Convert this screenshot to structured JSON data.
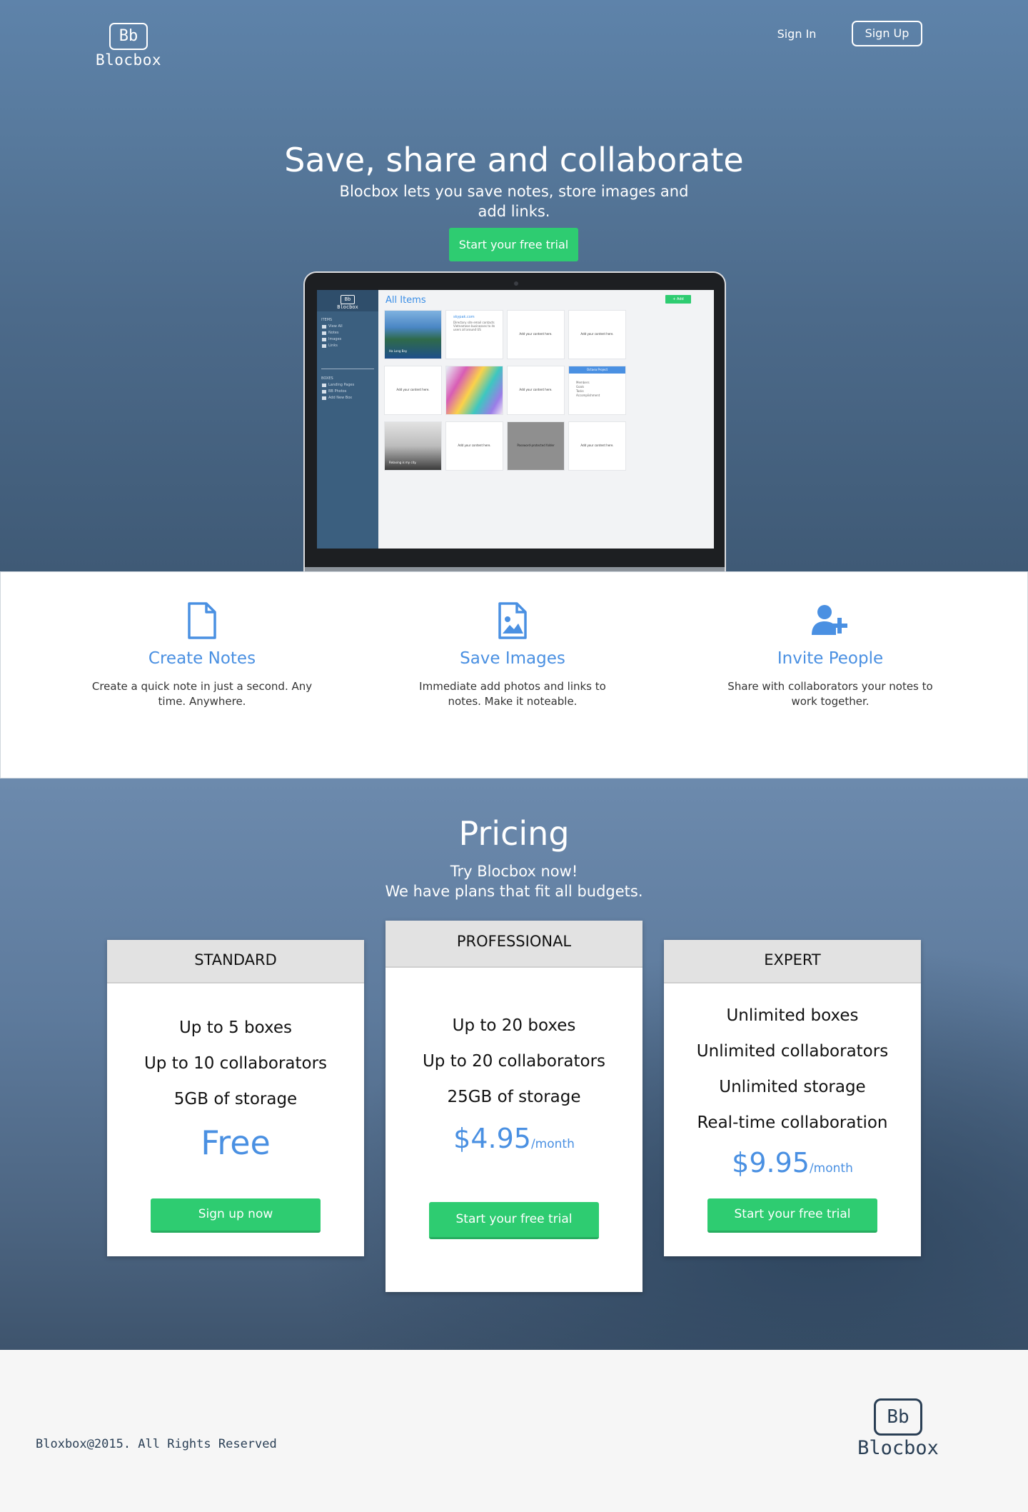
{
  "brand": {
    "logo_mark": "Bb",
    "name": "Blocbox"
  },
  "nav": {
    "sign_in": "Sign In",
    "sign_up": "Sign Up"
  },
  "hero": {
    "title": "Save, share and collaborate",
    "subtitle": "Blocbox lets you save notes, store images and add links.",
    "cta": "Start your free trial"
  },
  "app_preview": {
    "logo_mark": "Bb",
    "logo_name": "Blocbox",
    "title": "All Items",
    "add_label": "+ Add",
    "sidebar_items": [
      "ITEMS",
      "View All",
      "Notes",
      "Images",
      "Links"
    ],
    "sidebar_boxes": [
      "BOXES",
      "Landing Pages",
      "BB Photos",
      "Add New Box"
    ],
    "placeholder": "Add your content here.",
    "link_card_title": "skypak.com",
    "link_card_text": "Directory site email contacts Vietnamese businesses to its users all around US",
    "image_caption_1": "Ha Long Bay",
    "image_caption_2": "Relaxing is my city.",
    "folder_label": "Password-protected folder",
    "project_title": "Octaea Project",
    "project_items": [
      "Members",
      "Goals",
      "Tasks",
      "Accomplishment"
    ]
  },
  "features": [
    {
      "title": "Create Notes",
      "text": "Create a quick note in just a second. Any time. Anywhere.",
      "icon": "document-icon"
    },
    {
      "title": "Save Images",
      "text": "Immediate add photos and links to notes. Make it noteable.",
      "icon": "image-icon"
    },
    {
      "title": "Invite People",
      "text": "Share with collaborators your notes to work together.",
      "icon": "add-user-icon"
    }
  ],
  "pricing": {
    "title": "Pricing",
    "subtitle_1": "Try Blocbox now!",
    "subtitle_2": "We have plans that fit all budgets.",
    "plans": [
      {
        "name": "STANDARD",
        "features": [
          "Up to 5 boxes",
          "Up to 10 collaborators",
          "5GB of storage"
        ],
        "price": "Free",
        "period": "",
        "cta": "Sign up now"
      },
      {
        "name": "PROFESSIONAL",
        "features": [
          "Up to 20 boxes",
          "Up to 20 collaborators",
          "25GB of storage"
        ],
        "price": "$4.95",
        "period": "/month",
        "cta": "Start your free trial"
      },
      {
        "name": "EXPERT",
        "features": [
          "Unlimited boxes",
          "Unlimited collaborators",
          "Unlimited storage",
          "Real-time collaboration"
        ],
        "price": "$9.95",
        "period": "/month",
        "cta": "Start your free trial"
      }
    ]
  },
  "footer": {
    "copyright": "Bloxbox@2015. All Rights Reserved",
    "logo_mark": "Bb",
    "logo_name": "Blocbox"
  },
  "colors": {
    "accent_green": "#2ecc71",
    "accent_blue": "#4a90e2",
    "hero_blue": "#57799c",
    "dark_navy": "#2a3f55"
  }
}
